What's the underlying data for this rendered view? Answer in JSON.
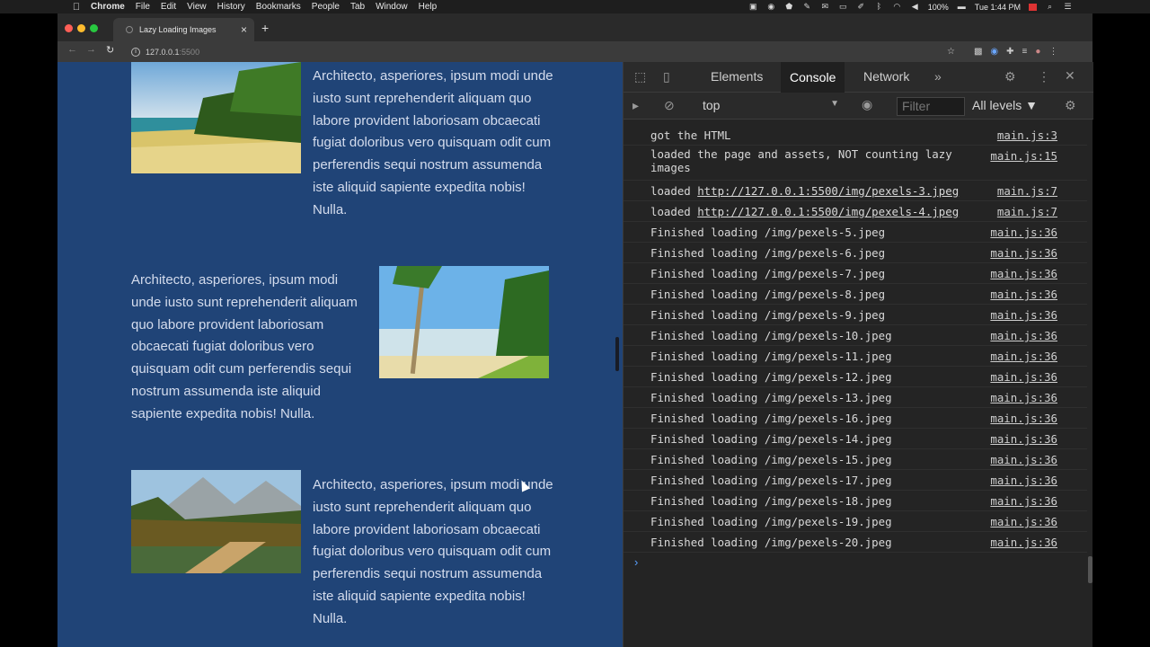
{
  "menubar": {
    "app": "Chrome",
    "items": [
      "File",
      "Edit",
      "View",
      "History",
      "Bookmarks",
      "People",
      "Tab",
      "Window",
      "Help"
    ],
    "battery": "100%",
    "clock": "Tue 1:44 PM"
  },
  "browser": {
    "tab_title": "Lazy Loading Images",
    "url_host": "127.0.0.1",
    "url_port": ":5500"
  },
  "page": {
    "paragraph": "Architecto, asperiores, ipsum modi unde iusto sunt reprehenderit aliquam quo labore provident laboriosam obcaecati fugiat doloribus vero quisquam odit cum perferendis sequi nostrum assumenda iste aliquid sapiente expedita nobis! Nulla."
  },
  "devtools": {
    "tabs": [
      "Elements",
      "Console",
      "Network"
    ],
    "more_tabs": "»",
    "context": "top",
    "filter_placeholder": "Filter",
    "levels": "All levels ▼",
    "console_rows": [
      {
        "text": "got the HTML",
        "source": "main.js:3"
      },
      {
        "text": "loaded the page and assets, NOT counting lazy images",
        "source": "main.js:15"
      },
      {
        "prefix": "loaded ",
        "link": "http://127.0.0.1:5500/img/pexels-3.jpeg",
        "source": "main.js:7"
      },
      {
        "prefix": "loaded ",
        "link": "http://127.0.0.1:5500/img/pexels-4.jpeg",
        "source": "main.js:7"
      },
      {
        "text": "Finished loading /img/pexels-5.jpeg",
        "source": "main.js:36"
      },
      {
        "text": "Finished loading /img/pexels-6.jpeg",
        "source": "main.js:36"
      },
      {
        "text": "Finished loading /img/pexels-7.jpeg",
        "source": "main.js:36"
      },
      {
        "text": "Finished loading /img/pexels-8.jpeg",
        "source": "main.js:36"
      },
      {
        "text": "Finished loading /img/pexels-9.jpeg",
        "source": "main.js:36"
      },
      {
        "text": "Finished loading /img/pexels-10.jpeg",
        "source": "main.js:36"
      },
      {
        "text": "Finished loading /img/pexels-11.jpeg",
        "source": "main.js:36"
      },
      {
        "text": "Finished loading /img/pexels-12.jpeg",
        "source": "main.js:36"
      },
      {
        "text": "Finished loading /img/pexels-13.jpeg",
        "source": "main.js:36"
      },
      {
        "text": "Finished loading /img/pexels-16.jpeg",
        "source": "main.js:36"
      },
      {
        "text": "Finished loading /img/pexels-14.jpeg",
        "source": "main.js:36"
      },
      {
        "text": "Finished loading /img/pexels-15.jpeg",
        "source": "main.js:36"
      },
      {
        "text": "Finished loading /img/pexels-17.jpeg",
        "source": "main.js:36"
      },
      {
        "text": "Finished loading /img/pexels-18.jpeg",
        "source": "main.js:36"
      },
      {
        "text": "Finished loading /img/pexels-19.jpeg",
        "source": "main.js:36"
      },
      {
        "text": "Finished loading /img/pexels-20.jpeg",
        "source": "main.js:36"
      }
    ],
    "prompt": "›"
  },
  "colors": {
    "page_bg": "#204477",
    "devtools_bg": "#242424"
  }
}
